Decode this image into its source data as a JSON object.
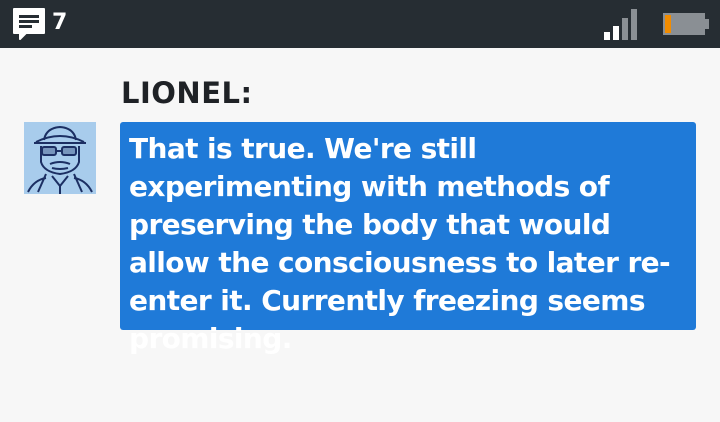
{
  "status_bar": {
    "notification_icon": "message-icon",
    "notification_count": "7",
    "signal_icon": "cellular-signal-icon",
    "battery_icon": "battery-low-icon",
    "colors": {
      "bar_bg": "#262d33",
      "signal_active": "#ffffff",
      "signal_inactive": "#8a8f94",
      "battery_level": "#f28c00"
    },
    "battery_level_percent": 15,
    "signal_bars_active": 2,
    "signal_bars_total": 4
  },
  "dialogue": {
    "speaker": "LIONEL:",
    "avatar_icon": "character-portrait-icon",
    "message": "That is true. We're still experimenting with methods of preserving the body that would allow the consciousness to later re-enter it. Currently freezing seems promising.",
    "colors": {
      "bubble_bg": "#1f7ad8",
      "bubble_text": "#ffffff",
      "avatar_bg": "#a8ccec",
      "speaker_text": "#1f2226"
    }
  }
}
